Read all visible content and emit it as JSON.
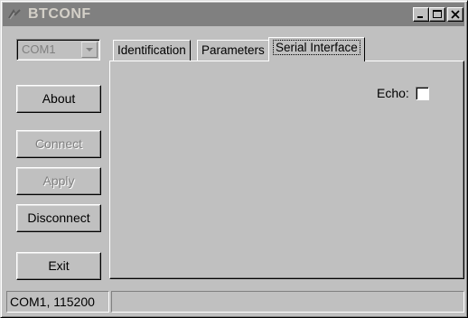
{
  "window": {
    "title": "BTCONF",
    "controls": {
      "minimize_icon": "minimize-icon",
      "maximize_icon": "maximize-icon",
      "close_icon": "close-icon"
    }
  },
  "port_select": {
    "value": "COM1"
  },
  "buttons": {
    "about": "About",
    "connect": "Connect",
    "apply": "Apply",
    "disconnect": "Disconnect",
    "exit": "Exit"
  },
  "tabs": [
    {
      "label": "Identification"
    },
    {
      "label": "Parameters"
    },
    {
      "label": "Serial Interface",
      "active": true
    }
  ],
  "serial_interface": {
    "echo_label": "Echo:",
    "echo_checked": false
  },
  "status_bar": {
    "connection": "COM1, 115200",
    "message": ""
  },
  "colors": {
    "face": "#c0c0c0",
    "titlebar_inactive": "#808080",
    "disabled_text": "#808080"
  }
}
